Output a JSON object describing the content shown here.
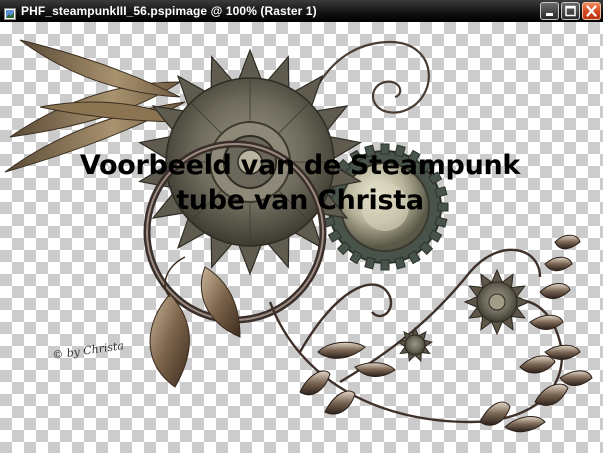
{
  "window": {
    "title": "PHF_steampunkIII_56.pspimage @ 100% (Raster 1)",
    "controls": [
      {
        "name": "minimize",
        "icon": "minimize-icon"
      },
      {
        "name": "maximize",
        "icon": "maximize-icon"
      },
      {
        "name": "close",
        "icon": "close-icon"
      }
    ]
  },
  "canvas": {
    "caption_line1": "Voorbeeld van de Steampunk",
    "caption_line2": "tube van Christa",
    "signature": "© by Christa",
    "transparency_colors": [
      "#ffffff",
      "#cccccc"
    ]
  }
}
